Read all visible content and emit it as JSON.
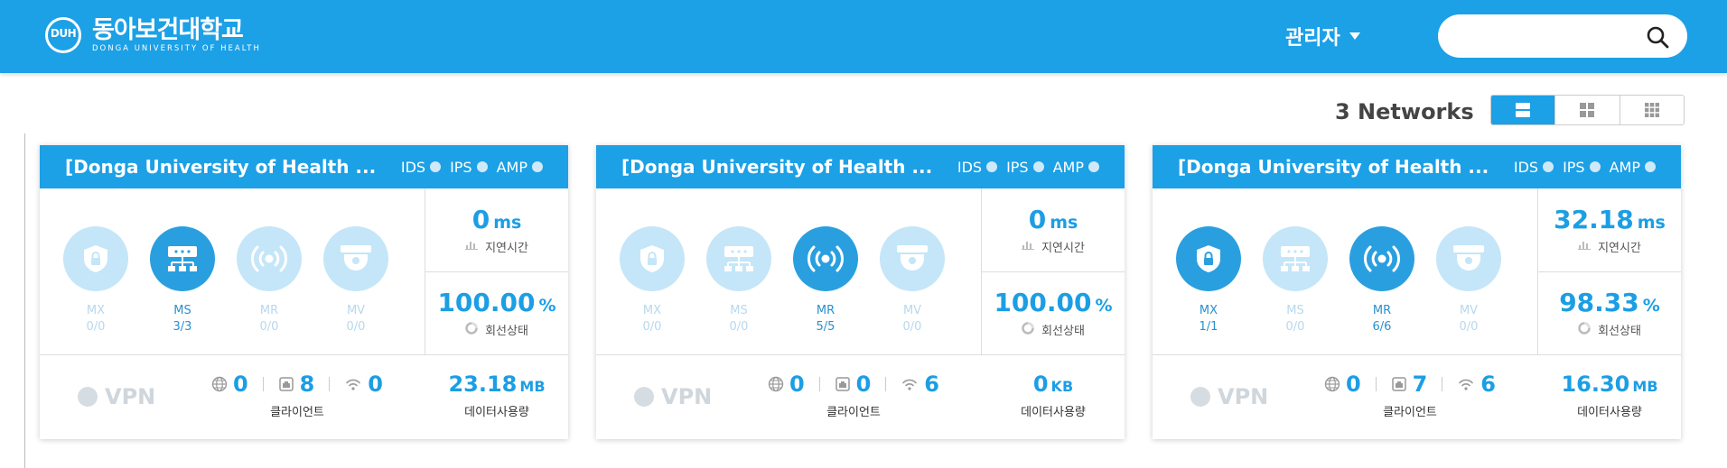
{
  "header": {
    "logo_ko": "동아보건대학교",
    "logo_en": "DONGA UNIVERSITY OF HEALTH",
    "logo_mono": "DUH",
    "admin_label": "관리자",
    "search_placeholder": ""
  },
  "toolbar": {
    "network_count": "3 Networks",
    "views": [
      "list-view",
      "grid-2-view",
      "grid-3-view"
    ],
    "active_view": "list-view"
  },
  "labels": {
    "ids": "IDS",
    "ips": "IPS",
    "amp": "AMP",
    "latency": "지연시간",
    "line_status": "회선상태",
    "vpn": "VPN",
    "clients": "클라이언트",
    "data_usage": "데이터사용량"
  },
  "networks": [
    {
      "title": "[Donga University of Health ...",
      "devices": [
        {
          "type": "MX",
          "count": "0/0",
          "active": false
        },
        {
          "type": "MS",
          "count": "3/3",
          "active": true
        },
        {
          "type": "MR",
          "count": "0/0",
          "active": false
        },
        {
          "type": "MV",
          "count": "0/0",
          "active": false
        }
      ],
      "latency": {
        "value": "0",
        "unit": "ms"
      },
      "line_status": {
        "value": "100.00",
        "unit": "%"
      },
      "clients": {
        "wired_global": "0",
        "wired": "8",
        "wireless": "0"
      },
      "usage": {
        "value": "23.18",
        "unit": "MB"
      }
    },
    {
      "title": "[Donga University of Health ...",
      "devices": [
        {
          "type": "MX",
          "count": "0/0",
          "active": false
        },
        {
          "type": "MS",
          "count": "0/0",
          "active": false
        },
        {
          "type": "MR",
          "count": "5/5",
          "active": true
        },
        {
          "type": "MV",
          "count": "0/0",
          "active": false
        }
      ],
      "latency": {
        "value": "0",
        "unit": "ms"
      },
      "line_status": {
        "value": "100.00",
        "unit": "%"
      },
      "clients": {
        "wired_global": "0",
        "wired": "0",
        "wireless": "6"
      },
      "usage": {
        "value": "0",
        "unit": "KB"
      }
    },
    {
      "title": "[Donga University of Health ...",
      "devices": [
        {
          "type": "MX",
          "count": "1/1",
          "active": true
        },
        {
          "type": "MS",
          "count": "0/0",
          "active": false
        },
        {
          "type": "MR",
          "count": "6/6",
          "active": true
        },
        {
          "type": "MV",
          "count": "0/0",
          "active": false
        }
      ],
      "latency": {
        "value": "32.18",
        "unit": "ms"
      },
      "line_status": {
        "value": "98.33",
        "unit": "%"
      },
      "clients": {
        "wired_global": "0",
        "wired": "7",
        "wireless": "6"
      },
      "usage": {
        "value": "16.30",
        "unit": "MB"
      }
    }
  ]
}
